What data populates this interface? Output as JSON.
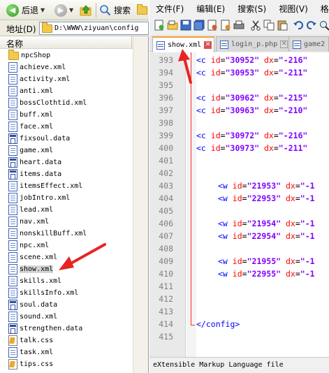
{
  "explorer": {
    "toolbar": {
      "back_label": "后退",
      "search_label": "搜索"
    },
    "address": {
      "label": "地址(D)",
      "path": "D:\\WWW\\ziyuan\\config"
    },
    "column_header": "名称",
    "files": [
      {
        "name": "npcShop",
        "type": "folder"
      },
      {
        "name": "achieve.xml",
        "type": "xml"
      },
      {
        "name": "activity.xml",
        "type": "xml"
      },
      {
        "name": "anti.xml",
        "type": "xml"
      },
      {
        "name": "bossClothtid.xml",
        "type": "xml"
      },
      {
        "name": "buff.xml",
        "type": "xml"
      },
      {
        "name": "face.xml",
        "type": "xml"
      },
      {
        "name": "fixsoul.data",
        "type": "data"
      },
      {
        "name": "game.xml",
        "type": "xml"
      },
      {
        "name": "heart.data",
        "type": "data"
      },
      {
        "name": "items.data",
        "type": "data"
      },
      {
        "name": "itemsEffect.xml",
        "type": "xml"
      },
      {
        "name": "jobIntro.xml",
        "type": "xml"
      },
      {
        "name": "lead.xml",
        "type": "xml"
      },
      {
        "name": "nav.xml",
        "type": "xml"
      },
      {
        "name": "nonskillBuff.xml",
        "type": "xml"
      },
      {
        "name": "npc.xml",
        "type": "xml"
      },
      {
        "name": "scene.xml",
        "type": "xml"
      },
      {
        "name": "show.xml",
        "type": "xml",
        "highlighted": true
      },
      {
        "name": "skills.xml",
        "type": "xml"
      },
      {
        "name": "skillsInfo.xml",
        "type": "xml"
      },
      {
        "name": "soul.data",
        "type": "data"
      },
      {
        "name": "sound.xml",
        "type": "xml"
      },
      {
        "name": "strengthen.data",
        "type": "data"
      },
      {
        "name": "talk.css",
        "type": "css"
      },
      {
        "name": "task.xml",
        "type": "xml"
      },
      {
        "name": "tips.css",
        "type": "css"
      }
    ]
  },
  "editor": {
    "menu": [
      "文件(F)",
      "编辑(E)",
      "搜索(S)",
      "视图(V)",
      "格式("
    ],
    "tabs": [
      {
        "label": "show.xml",
        "active": true
      },
      {
        "label": "login_p.php",
        "active": false
      },
      {
        "label": "game2",
        "active": false
      }
    ],
    "lines": [
      {
        "n": "393",
        "tag": "<c",
        "id": "\"30952\"",
        "dx": "\"-216\"",
        "indent": 1
      },
      {
        "n": "394",
        "tag": "<c",
        "id": "\"30953\"",
        "dx": "\"-211\"",
        "indent": 1
      },
      {
        "n": "395"
      },
      {
        "n": "396",
        "tag": "<c",
        "id": "\"30962\"",
        "dx": "\"-215\"",
        "indent": 1
      },
      {
        "n": "397",
        "tag": "<c",
        "id": "\"30963\"",
        "dx": "\"-210\"",
        "indent": 1
      },
      {
        "n": "398"
      },
      {
        "n": "399",
        "tag": "<c",
        "id": "\"30972\"",
        "dx": "\"-216\"",
        "indent": 1
      },
      {
        "n": "400",
        "tag": "<c",
        "id": "\"30973\"",
        "dx": "\"-211\"",
        "indent": 1
      },
      {
        "n": "401"
      },
      {
        "n": "402"
      },
      {
        "n": "403",
        "tag": "<w",
        "id": "\"21953\"",
        "dx": "\"-1",
        "indent": 2
      },
      {
        "n": "404",
        "tag": "<w",
        "id": "\"22953\"",
        "dx": "\"-1",
        "indent": 2
      },
      {
        "n": "405"
      },
      {
        "n": "406",
        "tag": "<w",
        "id": "\"21954\"",
        "dx": "\"-1",
        "indent": 2
      },
      {
        "n": "407",
        "tag": "<w",
        "id": "\"22954\"",
        "dx": "\"-1",
        "indent": 2
      },
      {
        "n": "408"
      },
      {
        "n": "409",
        "tag": "<w",
        "id": "\"21955\"",
        "dx": "\"-1",
        "indent": 2
      },
      {
        "n": "410",
        "tag": "<w",
        "id": "\"22955\"",
        "dx": "\"-1",
        "indent": 2
      },
      {
        "n": "411"
      },
      {
        "n": "412"
      },
      {
        "n": "413"
      },
      {
        "n": "414",
        "closing": "</config>",
        "indent": 1
      },
      {
        "n": "415"
      }
    ],
    "attr_id": "id",
    "attr_dx": "dx",
    "status": "eXtensible Markup Language file"
  },
  "colors": {
    "tag": "#0000ff",
    "attribute": "#ff0000",
    "value": "#8000ff",
    "annotation_arrow": "#e82323",
    "active_tab_accent": "#f0a030"
  }
}
